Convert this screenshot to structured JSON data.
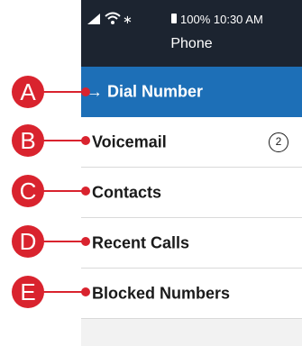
{
  "status_bar": {
    "bluetooth_icon": "bluetooth-icon",
    "battery_text": "100%",
    "time": "10:30 AM"
  },
  "app": {
    "title": "Phone"
  },
  "menu": [
    {
      "label": "→ Dial Number",
      "active": true
    },
    {
      "label": "Voicemail",
      "badge": "2"
    },
    {
      "label": "Contacts"
    },
    {
      "label": "Recent Calls"
    },
    {
      "label": "Blocked Numbers"
    }
  ],
  "callouts": [
    "A",
    "B",
    "C",
    "D",
    "E"
  ],
  "colors": {
    "status_bar": "#1c2430",
    "active_item": "#1d6fb7",
    "callout": "#d9232e"
  }
}
